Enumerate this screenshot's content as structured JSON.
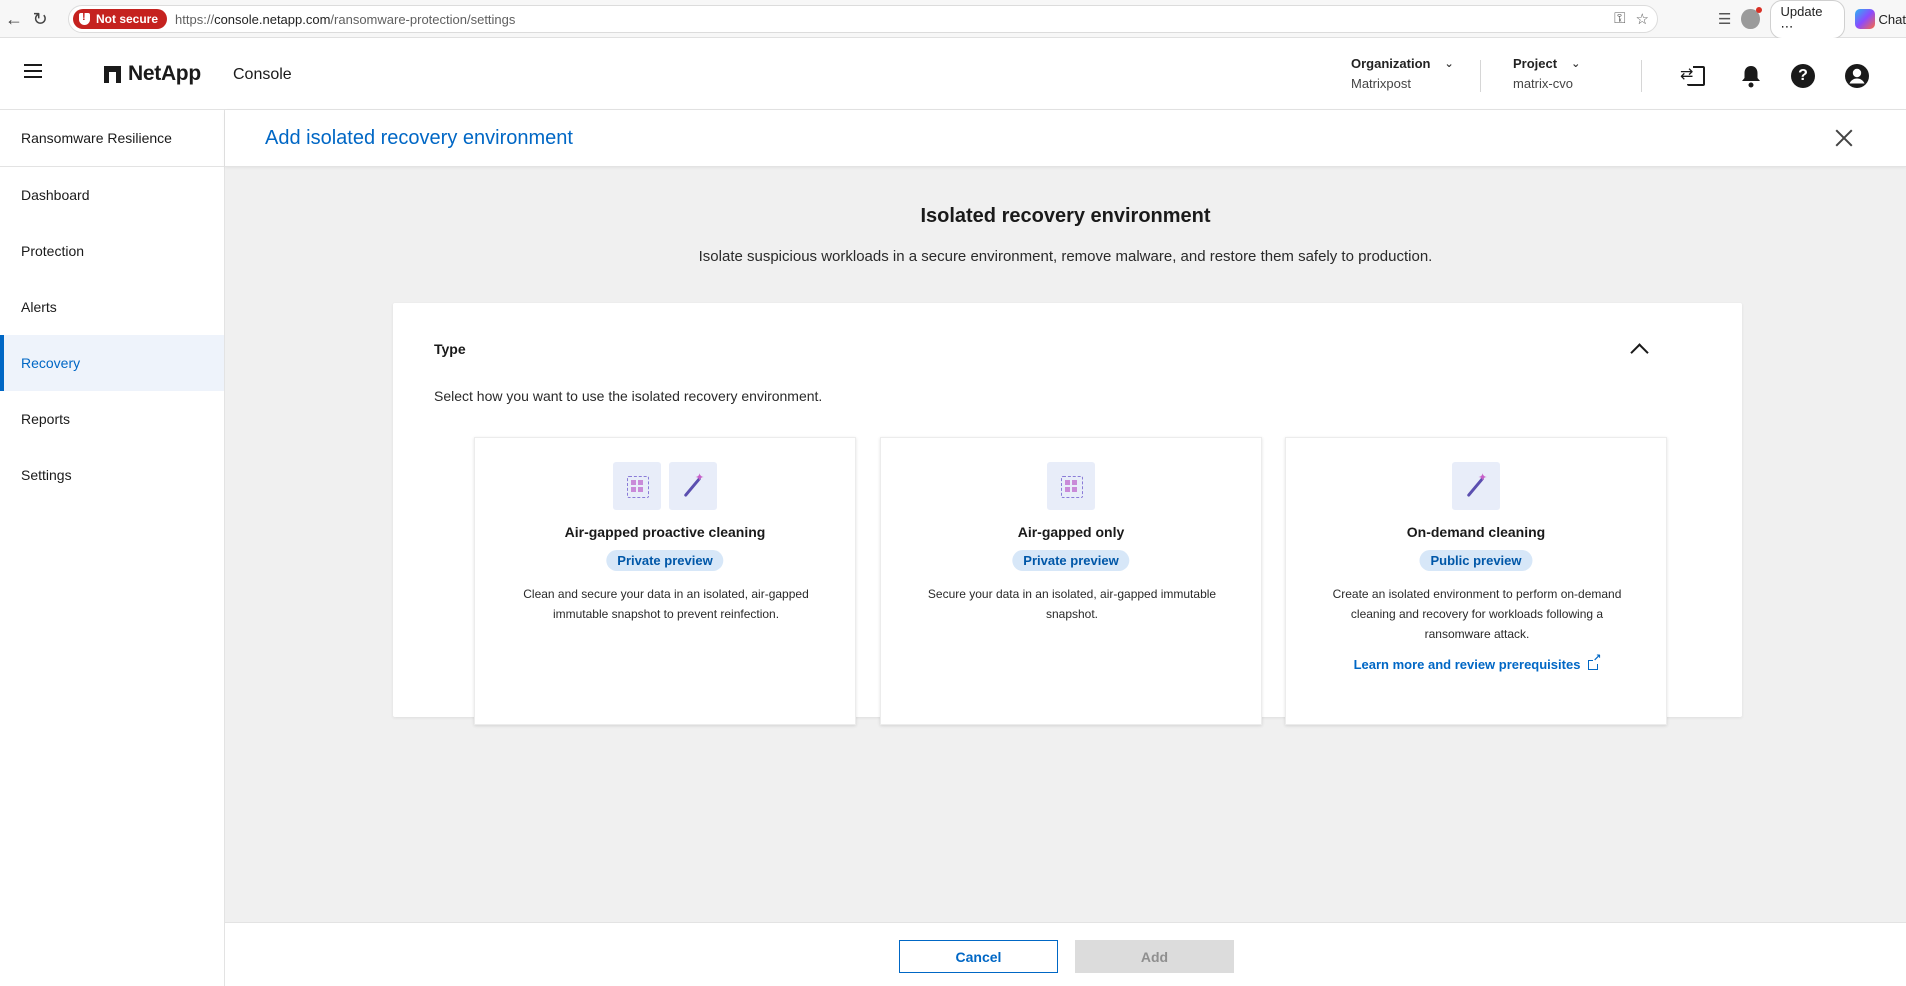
{
  "browser": {
    "security_label": "Not secure",
    "url_prefix": "https://",
    "url_host": "console.netapp.com",
    "url_path": "/ransomware-protection/settings",
    "update_label": "Update",
    "chat_label": "Chat"
  },
  "header": {
    "brand": "NetApp",
    "app_label": "Console",
    "organization": {
      "label": "Organization",
      "value": "Matrixpost"
    },
    "project": {
      "label": "Project",
      "value": "matrix-cvo"
    }
  },
  "sidebar": {
    "title": "Ransomware Resilience",
    "items": [
      {
        "label": "Dashboard"
      },
      {
        "label": "Protection"
      },
      {
        "label": "Alerts"
      },
      {
        "label": "Recovery"
      },
      {
        "label": "Reports"
      },
      {
        "label": "Settings"
      }
    ],
    "active_index": 3
  },
  "panel": {
    "title": "Add isolated recovery environment",
    "section_title": "Isolated recovery environment",
    "section_subtitle": "Isolate suspicious workloads in a secure environment, remove malware, and restore them safely to production.",
    "type_label": "Type",
    "type_description": "Select how you want to use the isolated recovery environment."
  },
  "options": [
    {
      "name": "Air-gapped proactive cleaning",
      "badge": "Private preview",
      "description": "Clean and secure your data in an isolated, air-gapped immutable snapshot to prevent reinfection.",
      "icons": [
        "snapshot-grid-icon",
        "magic-wand-icon"
      ]
    },
    {
      "name": "Air-gapped only",
      "badge": "Private preview",
      "description": "Secure your data in an isolated, air-gapped immutable snapshot.",
      "icons": [
        "snapshot-grid-icon"
      ]
    },
    {
      "name": "On-demand cleaning",
      "badge": "Public preview",
      "description": "Create an isolated environment to perform on-demand cleaning and recovery for workloads following a ransomware attack.",
      "link": "Learn more and review prerequisites",
      "icons": [
        "magic-wand-icon"
      ]
    }
  ],
  "footer": {
    "cancel_label": "Cancel",
    "add_label": "Add"
  },
  "colors": {
    "accent": "#0067c5",
    "not_secure": "#c5221f",
    "badge_bg": "#d7e7f8"
  }
}
